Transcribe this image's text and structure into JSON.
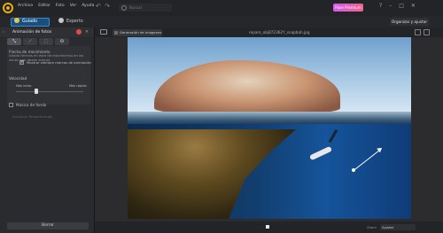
{
  "menu": [
    "Archivo",
    "Editar",
    "Foto",
    "Ver",
    "Ayuda"
  ],
  "undo_redo": "↶ ↷",
  "search": {
    "placeholder": "Buscar"
  },
  "premium": {
    "label": "Pase Premium"
  },
  "window_controls": [
    "?",
    "–",
    "□",
    "✕"
  ],
  "modes": {
    "guided": "Guiado",
    "expert": "Experto"
  },
  "organize": {
    "label": "Organizar y ajustar"
  },
  "panel": {
    "title": "Animación de fotos",
    "tool_tabs": [
      "⤡",
      "⟋",
      "⬚",
      "✪"
    ],
    "motion_label": "Flecha de movimiento",
    "motion_desc": "Añada flechas en este de movimiento en las zonas que desee animar",
    "show_mask_label": "Mostrar siempre marcas de animación",
    "speed_label": "Velocidad",
    "speed_min": "Más lento",
    "speed_max": "Más rápido",
    "speed_value": 0.3,
    "bg_music_label": "Música de fondo",
    "music_sub": "Duración  Temporización",
    "apply_label": "Borrar"
  },
  "canvas": {
    "generate_label": "Generación de imagenes tal",
    "file_name": "reparo_obj872362Y_snapbah.jpg"
  },
  "bottom": {
    "zoom_label": "Zoom",
    "zoom_value": "Ajustar"
  }
}
